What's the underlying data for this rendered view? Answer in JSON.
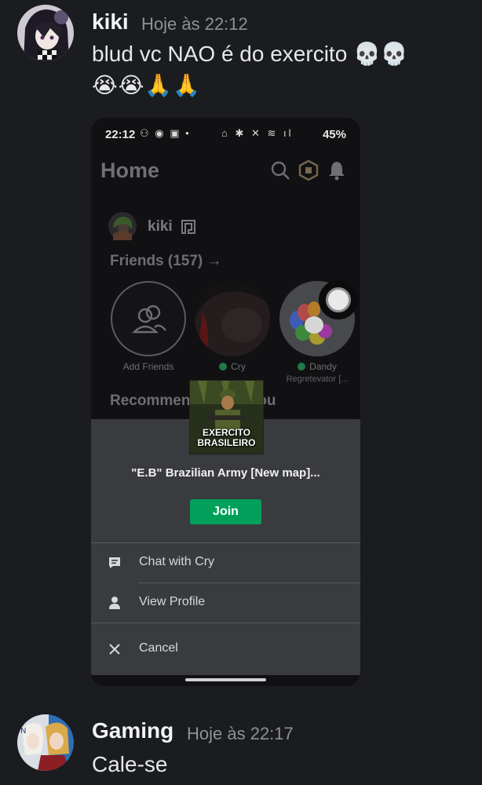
{
  "messages": [
    {
      "author": "kiki",
      "timestamp": "Hoje às 22:12",
      "text": "blud vc NAO é do exercito 💀💀",
      "text_line2": "😭😭🙏🙏"
    },
    {
      "author": "Gaming",
      "timestamp": "Hoje às 22:17",
      "text": "Cale-se"
    }
  ],
  "screenshot": {
    "status_bar": {
      "time": "22:12",
      "battery": "45%",
      "left_icons": "⚇ ◉ ▣ •",
      "right_icons": "⌂ ✱ ✕ ≋ ıl"
    },
    "app": {
      "page_title": "Home",
      "profile_name": "kiki",
      "friends_heading": "Friends (157) →",
      "friends": [
        {
          "name": "Add Friends",
          "online": false,
          "subtitle": ""
        },
        {
          "name": "Cry",
          "online": true,
          "subtitle": ""
        },
        {
          "name": "Dandy",
          "online": true,
          "subtitle": "Regretevator [..."
        }
      ],
      "recommended_heading": "Recommended For You",
      "accent_online": "#1e7a47"
    },
    "sheet": {
      "game_thumbnail_text": "EXERCITO BRASILEIRO",
      "game_title": "\"E.B\" Brazilian Army [New map]...",
      "join_label": "Join",
      "join_color": "#00a05a",
      "menu": [
        {
          "label": "Chat with Cry",
          "icon": "chat-icon"
        },
        {
          "label": "View Profile",
          "icon": "person-icon"
        },
        {
          "label": "Cancel",
          "icon": "close-icon"
        }
      ]
    }
  }
}
